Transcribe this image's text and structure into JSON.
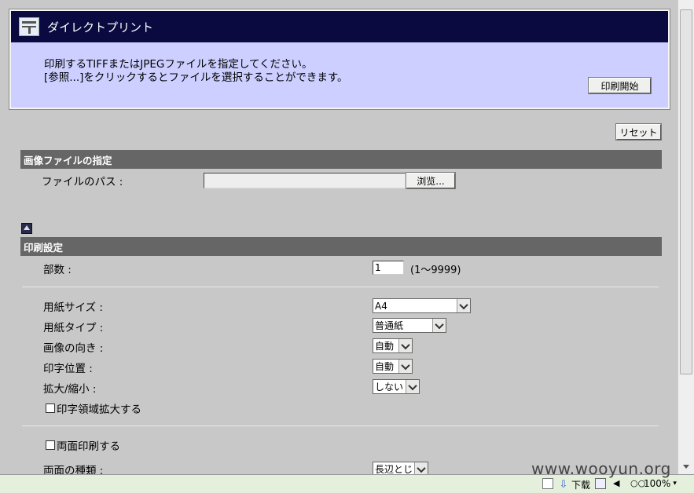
{
  "header": {
    "title": "ダイレクトプリント",
    "message_line1": "印刷するTIFFまたはJPEGファイルを指定してください。",
    "message_line2": "[参照...]をクリックするとファイルを選択することができます。",
    "start_button": "印刷開始"
  },
  "reset_button": "リセット",
  "file_section": {
    "title": "画像ファイルの指定",
    "path_label": "ファイルのパス :",
    "path_value": "",
    "browse_button": "浏览..."
  },
  "print_section": {
    "title": "印刷設定",
    "copies_label": "部数 :",
    "copies_value": "1",
    "copies_range": "(1～9999)",
    "paper_size_label": "用紙サイズ :",
    "paper_size_value": "A4",
    "paper_type_label": "用紙タイプ :",
    "paper_type_value": "普通紙",
    "orientation_label": "画像の向き :",
    "orientation_value": "自動",
    "print_position_label": "印字位置 :",
    "print_position_value": "自動",
    "scale_label": "拡大/縮小 :",
    "scale_value": "しない",
    "expand_area_label": "印字領域拡大する",
    "duplex_label": "両面印刷する",
    "duplex_type_label": "両面の種類 :",
    "duplex_type_value": "長辺とじ"
  },
  "statusbar": {
    "download_label": "下载",
    "zoom": "100%"
  },
  "watermark": "www.wooyun.org"
}
